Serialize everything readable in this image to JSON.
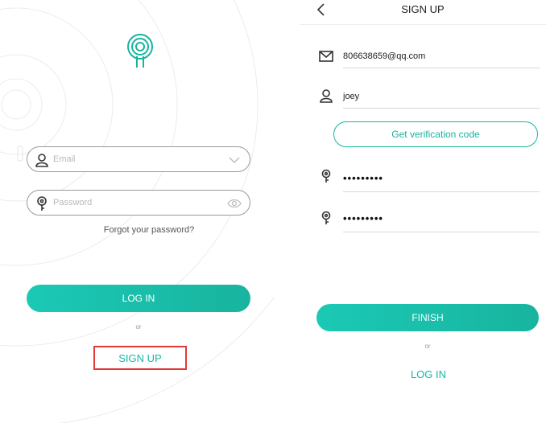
{
  "login": {
    "email_placeholder": "Email",
    "password_placeholder": "Password",
    "forgot_label": "Forgot your password?",
    "login_label": "LOG IN",
    "or_label": "or",
    "signup_label": "SIGN UP"
  },
  "signup": {
    "title": "SIGN UP",
    "email_value": "806638659@qq.com",
    "username_value": "joey",
    "verify_label": "Get verification code",
    "password_value": "•••••••••",
    "confirm_value": "•••••••••",
    "finish_label": "FINISH",
    "or_label": "or",
    "login_label": "LOG IN"
  },
  "colors": {
    "accent": "#18b49f",
    "highlight": "#e23a3a"
  },
  "icons": {
    "logo": "pin-logo-icon",
    "email": "user-icon",
    "password": "key-icon",
    "dropdown": "chevron-down-icon",
    "visibility": "eye-icon",
    "back": "chevron-left-icon",
    "mail": "mail-icon"
  }
}
